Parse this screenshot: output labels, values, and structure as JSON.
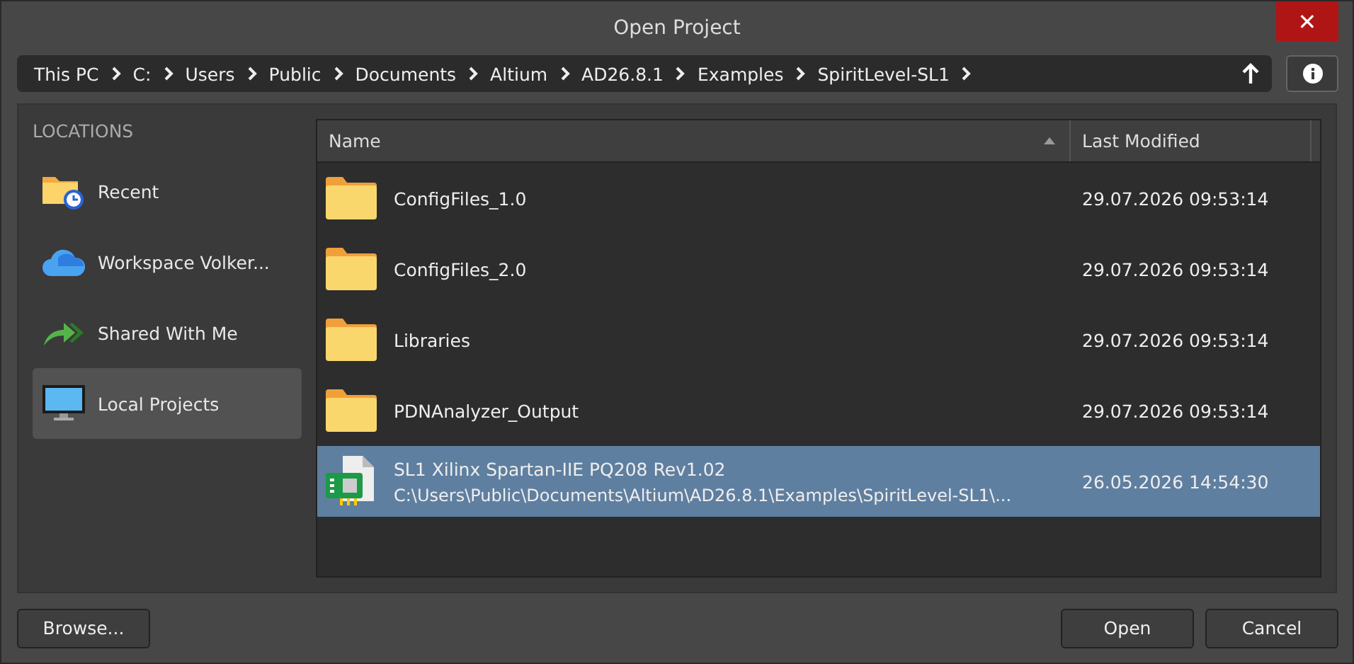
{
  "window": {
    "title": "Open Project",
    "close": "✕"
  },
  "breadcrumb": [
    "This PC",
    "C:",
    "Users",
    "Public",
    "Documents",
    "Altium",
    "AD26.8.1",
    "Examples",
    "SpiritLevel-SL1"
  ],
  "sidebar": {
    "heading": "LOCATIONS",
    "items": [
      {
        "label": "Recent",
        "kind": "recent",
        "selected": false
      },
      {
        "label": "Workspace Volker...",
        "kind": "cloud",
        "selected": false
      },
      {
        "label": "Shared With Me",
        "kind": "shared",
        "selected": false
      },
      {
        "label": "Local Projects",
        "kind": "computer",
        "selected": true
      }
    ]
  },
  "table": {
    "columns": [
      "Name",
      "Last Modified"
    ],
    "rows": [
      {
        "kind": "folder",
        "name": "ConfigFiles_1.0",
        "modified": "29.07.2026 09:53:14",
        "selected": false
      },
      {
        "kind": "folder",
        "name": "ConfigFiles_2.0",
        "modified": "29.07.2026 09:53:14",
        "selected": false
      },
      {
        "kind": "folder",
        "name": "Libraries",
        "modified": "29.07.2026 09:53:14",
        "selected": false
      },
      {
        "kind": "folder",
        "name": "PDNAnalyzer_Output",
        "modified": "29.07.2026 09:53:14",
        "selected": false
      },
      {
        "kind": "project",
        "name": "SL1 Xilinx Spartan-IIE PQ208 Rev1.02",
        "path": "C:\\Users\\Public\\Documents\\Altium\\AD26.8.1\\Examples\\SpiritLevel-SL1\\...",
        "modified": "26.05.2026 14:54:30",
        "selected": true
      }
    ]
  },
  "buttons": {
    "browse": "Browse...",
    "open": "Open",
    "cancel": "Cancel"
  }
}
